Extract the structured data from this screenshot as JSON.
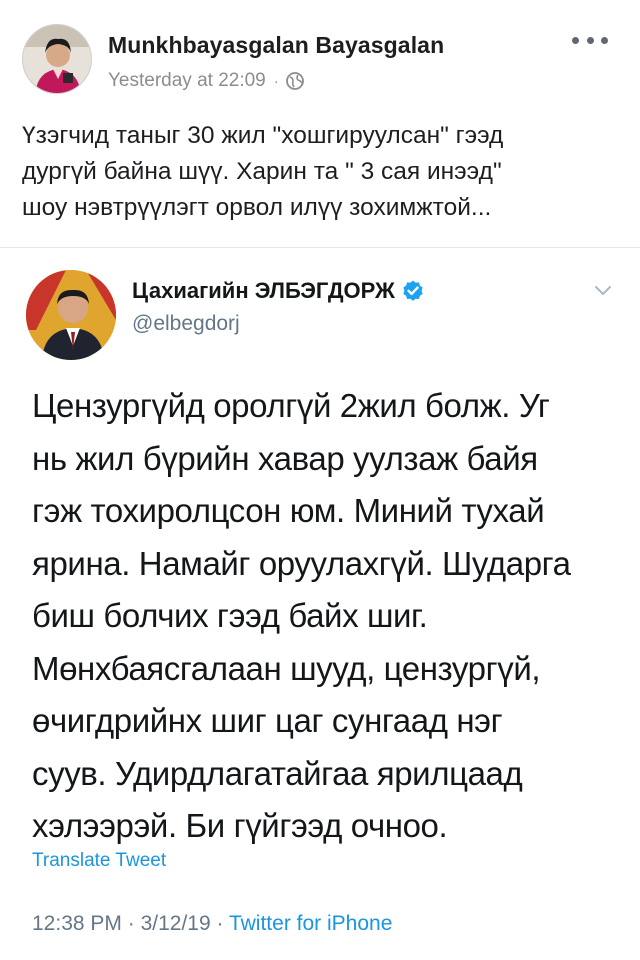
{
  "facebook_post": {
    "author_name": "Munkhbayasgalan Bayasgalan",
    "timestamp": "Yesterday at 22:09",
    "separator": "·",
    "privacy_icon": "globe-icon",
    "more_icon": "more-options-icon",
    "text_lines": [
      "Үзэгчид таныг 30 жил \"хошгируулсан\" гээд",
      "дургүй байна шүү. Харин та \" 3 сая инээд\"",
      "шоу нэвтрүүлэгт орвол илүү зохимжтой..."
    ]
  },
  "tweet": {
    "display_name": "Цахиагийн ЭЛБЭГДОРЖ",
    "verified_icon": "verified-badge-icon",
    "handle": "@elbegdorj",
    "menu_icon": "chevron-down-icon",
    "text_lines": [
      "Цензургүйд оролгүй 2жил болж. Уг",
      "нь жил бүрийн хавар уулзаж байя",
      "гэж тохиролцсон юм. Миний тухай",
      "ярина. Намайг оруулахгүй. Шударга",
      "биш болчих гээд байх шиг.",
      "Мөнхбаясгалаан шууд, цензургүй,",
      "өчигдрийнх шиг цаг сунгаад нэг",
      "суув. Удирдлагатайгаа ярилцаад",
      "хэлээрэй. Би гүйгээд очноо."
    ],
    "translate_label": "Translate Tweet",
    "time": "12:38 PM",
    "date": "3/12/19",
    "separator": "·",
    "source": "Twitter for iPhone"
  },
  "colors": {
    "facebook_meta_gray": "#8a8d91",
    "twitter_blue": "#1b95e0",
    "twitter_gray": "#657786",
    "divider": "#e4e6eb"
  }
}
